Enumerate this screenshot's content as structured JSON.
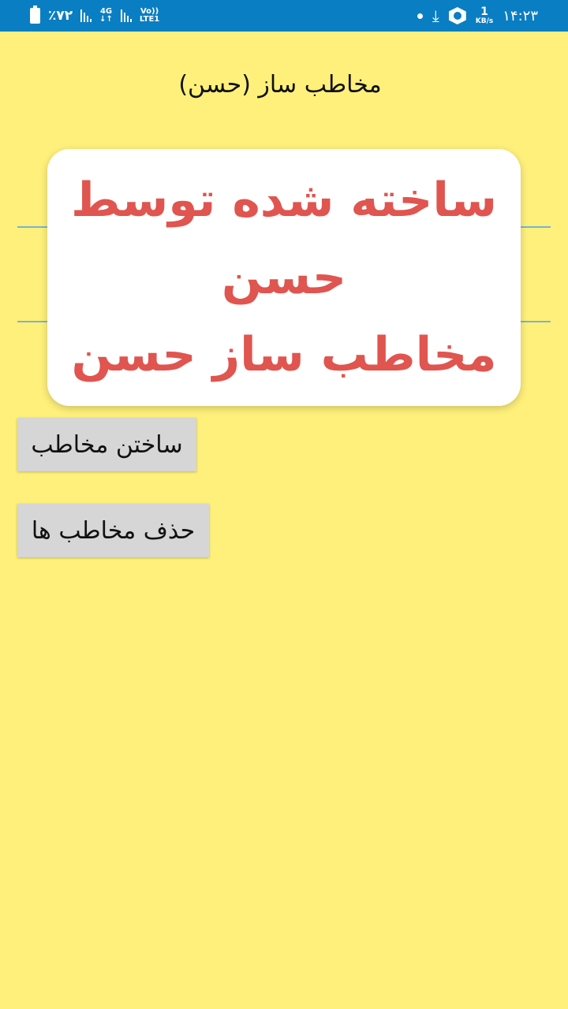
{
  "status_bar": {
    "battery_text": "٪۷۲",
    "network_type": "4G",
    "volte_label": "Vo))",
    "lte_label": "LTE1",
    "speed_value": "1",
    "speed_unit": "KB/s",
    "time": "۱۴:۲۳",
    "icons": [
      "battery-icon",
      "signal-icon",
      "data-arrows-icon",
      "dot-icon",
      "download-icon",
      "hexagon-app-icon"
    ]
  },
  "app": {
    "title": "مخاطب ساز (حسن)"
  },
  "dialog": {
    "line1": "ساخته شده توسط",
    "line2": "حسن",
    "line3": "مخاطب ساز حسن"
  },
  "buttons": {
    "create_label": "ساختن مخاطب",
    "delete_label": "حذف مخاطب ها"
  },
  "colors": {
    "background": "#fff07b",
    "status_bar": "#0a7ec2",
    "dialog_text": "#e0554f",
    "button_bg": "#d6d6d6"
  }
}
